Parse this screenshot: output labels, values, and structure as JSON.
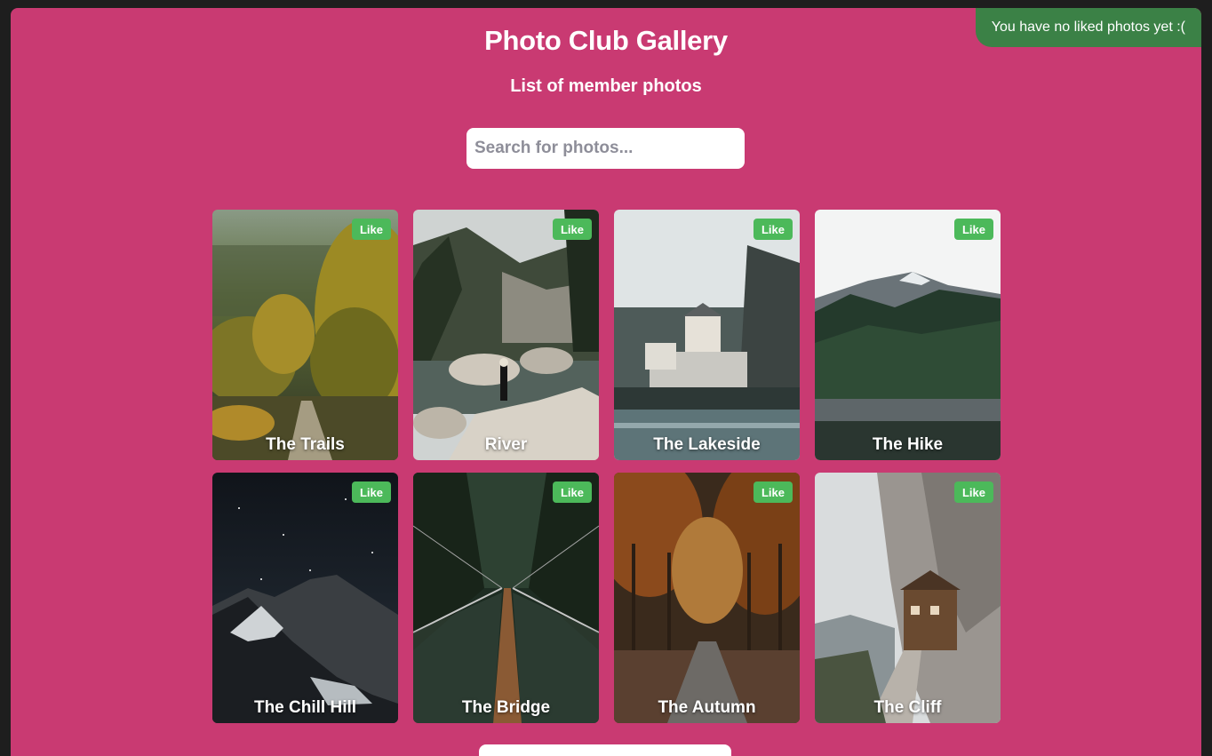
{
  "notice": {
    "text": "You have no liked photos yet :("
  },
  "header": {
    "title": "Photo Club Gallery",
    "subtitle": "List of member photos"
  },
  "search": {
    "placeholder": "Search for photos...",
    "value": ""
  },
  "like_label": "Like",
  "photos": [
    {
      "title": "The Trails",
      "scene": "forest-trail"
    },
    {
      "title": "River",
      "scene": "river-rocks"
    },
    {
      "title": "The Lakeside",
      "scene": "lakeside-houses"
    },
    {
      "title": "The Hike",
      "scene": "mountain-forest"
    },
    {
      "title": "The Chill Hill",
      "scene": "night-mountain"
    },
    {
      "title": "The Bridge",
      "scene": "suspension-bridge"
    },
    {
      "title": "The Autumn",
      "scene": "autumn-road"
    },
    {
      "title": "The Cliff",
      "scene": "cliff-house"
    }
  ]
}
